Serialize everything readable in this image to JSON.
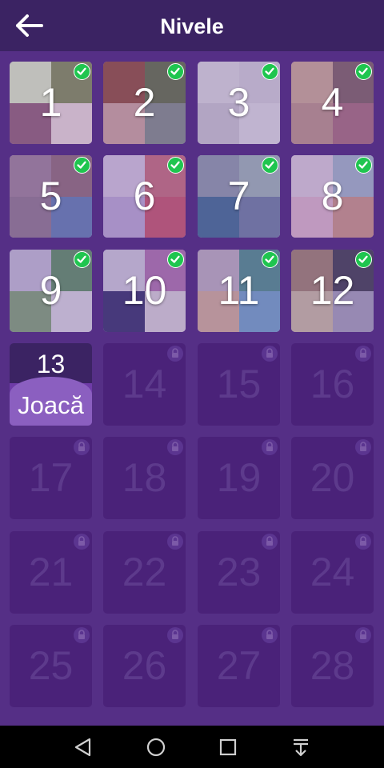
{
  "header": {
    "title": "Nivele",
    "back_icon": "arrow-left-icon"
  },
  "levels": [
    {
      "number": "1",
      "state": "completed",
      "colors": [
        "#d9e6c2",
        "#7d8a55",
        "#8c5c74",
        "#e6d6d6"
      ]
    },
    {
      "number": "2",
      "state": "completed",
      "colors": [
        "#8c4a3a",
        "#5d6b45",
        "#c9a19a",
        "#7e8a86"
      ]
    },
    {
      "number": "3",
      "state": "completed",
      "colors": [
        "#d7d4dc",
        "#cfcbd6",
        "#c6c3cd",
        "#dad7e0"
      ]
    },
    {
      "number": "4",
      "state": "completed",
      "colors": [
        "#c8a592",
        "#7a5d62",
        "#b88f87",
        "#a3697b"
      ]
    },
    {
      "number": "5",
      "state": "completed",
      "colors": [
        "#9a7f96",
        "#8d6876",
        "#8d758c",
        "#5f7bb0"
      ]
    },
    {
      "number": "6",
      "state": "completed",
      "colors": [
        "#d0c3dc",
        "#c26a79",
        "#b7a5d2",
        "#c2536a"
      ]
    },
    {
      "number": "7",
      "state": "completed",
      "colors": [
        "#8a96a8",
        "#9ab0b4",
        "#3c6890",
        "#6a7aa0"
      ]
    },
    {
      "number": "8",
      "state": "completed",
      "colors": [
        "#d7c8d9",
        "#9fb0c6",
        "#d8b2c8",
        "#c69184"
      ]
    },
    {
      "number": "9",
      "state": "completed",
      "colors": [
        "#bfb9d3",
        "#5b8b62",
        "#7d9f73",
        "#d6d2de"
      ]
    },
    {
      "number": "10",
      "state": "completed",
      "colors": [
        "#cbc5d8",
        "#a96eab",
        "#322d6a",
        "#d4ccd6"
      ]
    },
    {
      "number": "11",
      "state": "completed",
      "colors": [
        "#b9abbd",
        "#4c8a8a",
        "#cda996",
        "#6e9ec7"
      ]
    },
    {
      "number": "12",
      "state": "completed",
      "colors": [
        "#9b7d6c",
        "#3d3b4f",
        "#c7b6a0",
        "#a19bb8"
      ]
    },
    {
      "number": "13",
      "state": "current",
      "play_label": "Joacă"
    },
    {
      "number": "14",
      "state": "locked"
    },
    {
      "number": "15",
      "state": "locked"
    },
    {
      "number": "16",
      "state": "locked"
    },
    {
      "number": "17",
      "state": "locked"
    },
    {
      "number": "18",
      "state": "locked"
    },
    {
      "number": "19",
      "state": "locked"
    },
    {
      "number": "20",
      "state": "locked"
    },
    {
      "number": "21",
      "state": "locked"
    },
    {
      "number": "22",
      "state": "locked"
    },
    {
      "number": "23",
      "state": "locked"
    },
    {
      "number": "24",
      "state": "locked"
    },
    {
      "number": "25",
      "state": "locked"
    },
    {
      "number": "26",
      "state": "locked"
    },
    {
      "number": "27",
      "state": "locked"
    },
    {
      "number": "28",
      "state": "locked"
    }
  ],
  "icons": {
    "completed": "checkmark-icon",
    "locked": "lock-icon"
  },
  "navbar": {
    "buttons": [
      "back-triangle-icon",
      "home-circle-icon",
      "recents-square-icon",
      "notification-drawer-icon"
    ]
  },
  "colors": {
    "background": "#552f86",
    "header": "#3b2363",
    "locked_tile": "#4a2279",
    "check_green": "#1fc54f",
    "current_accent": "#8b5fc0"
  }
}
